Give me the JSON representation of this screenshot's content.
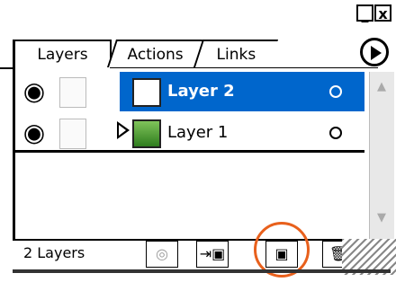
{
  "window": {
    "minimize_label": "_",
    "close_label": "x"
  },
  "tabs": [
    {
      "label": "Layers",
      "active": true
    },
    {
      "label": "Actions",
      "active": false
    },
    {
      "label": "Links",
      "active": false
    }
  ],
  "layers": [
    {
      "name": "Layer 2",
      "selected": true,
      "visible": true,
      "icon": "eye-icon"
    },
    {
      "name": "Layer 1",
      "selected": false,
      "visible": true,
      "icon": "eye-icon",
      "expandable": true
    }
  ],
  "footer": {
    "count_label": "2 Layers"
  },
  "colors": {
    "selection": "#0066cc",
    "highlight_ring": "#e8601c",
    "layer1_thumb": "#4a9a2e"
  },
  "icons": {
    "eye": "👁",
    "move_to_layer": "⇥▣",
    "new_layer": "▣",
    "delete": "🗑",
    "target": "◎"
  }
}
